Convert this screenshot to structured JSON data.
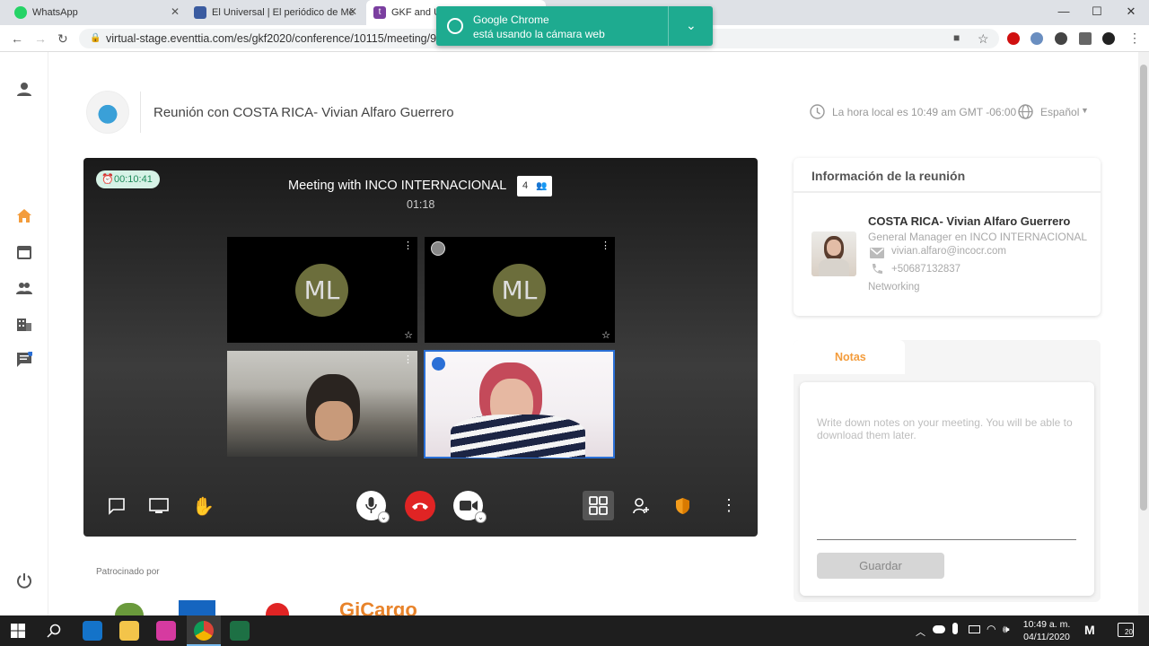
{
  "browser": {
    "tabs": [
      {
        "label": "WhatsApp"
      },
      {
        "label": "El Universal | El periódico de Mé"
      },
      {
        "label": "GKF and UL"
      }
    ],
    "url": "virtual-stage.eventtia.com/es/gkf2020/conference/10115/meeting/9738",
    "notification": {
      "line1": "Google Chrome",
      "line2": "está usando la cámara web"
    }
  },
  "header": {
    "title": "Reunión con COSTA RICA- Vivian Alfaro Guerrero",
    "local_time": "La hora local es 10:49 am GMT -06:00",
    "language": "Español"
  },
  "meeting": {
    "timer": "00:10:41",
    "title": "Meeting with INCO INTERNACIONAL",
    "elapsed": "01:18",
    "participants": "4",
    "tiles": [
      {
        "initials": "ML"
      },
      {
        "initials": "ML"
      }
    ]
  },
  "info": {
    "heading": "Información de la reunión",
    "name": "COSTA RICA- Vivian Alfaro Guerrero",
    "position": "General Manager en INCO INTERNACIONAL",
    "email": "vivian.alfaro@incocr.com",
    "phone": "+50687132837",
    "category": "Networking"
  },
  "notes": {
    "tab": "Notas",
    "placeholder": "Write down notes on your meeting. You will be able to download them later.",
    "save": "Guardar"
  },
  "sponsors": {
    "label": "Patrocinado por",
    "gicargo": "GiCargo"
  },
  "taskbar": {
    "time": "10:49 a. m.",
    "date": "04/11/2020",
    "notifications": "20"
  },
  "colors": {
    "accent": "#f39c3c",
    "teal": "#1eab90",
    "hangup": "#e02424"
  }
}
